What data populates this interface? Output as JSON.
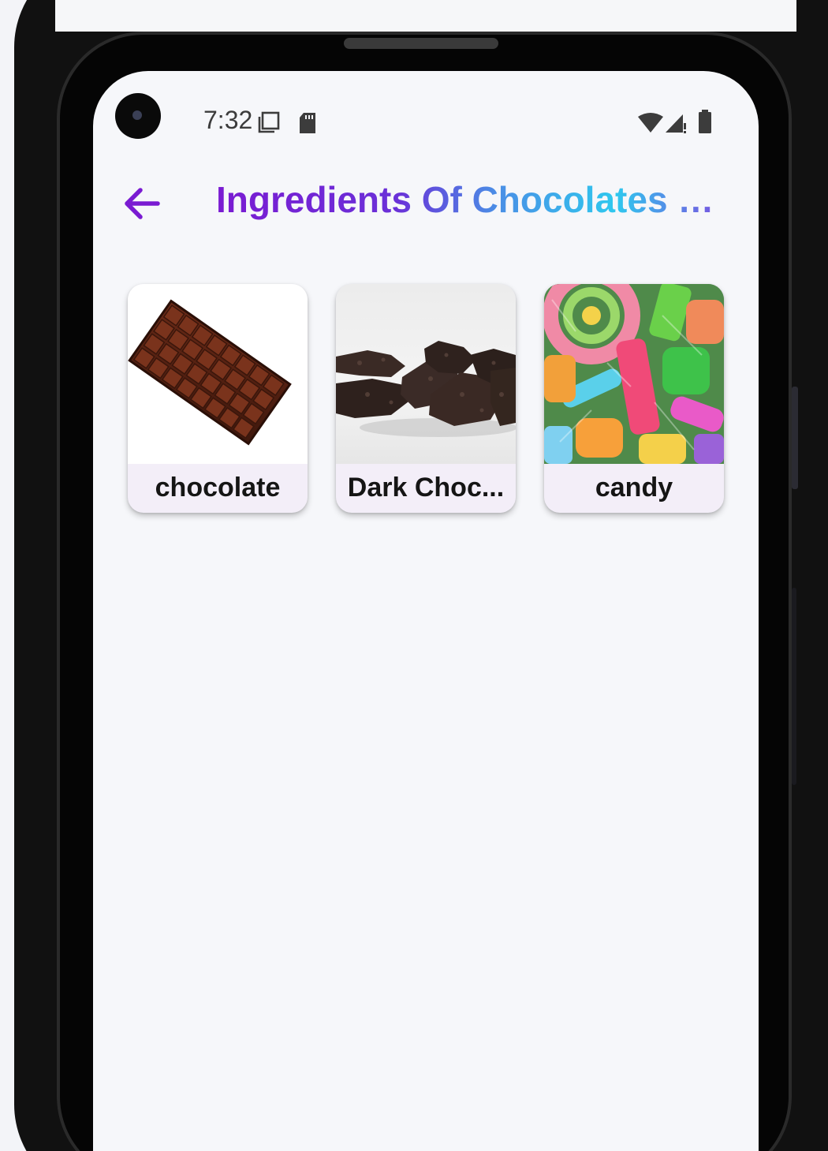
{
  "status_bar": {
    "time": "7:32",
    "icons": [
      "screen-icon",
      "sd-card-icon",
      "wifi-icon",
      "signal-icon",
      "battery-icon"
    ]
  },
  "app_bar": {
    "title": "Ingredients Of Chocolates & ...",
    "back_icon": "arrow-left-icon",
    "back_color": "#7a1bd2"
  },
  "items": [
    {
      "label": "chocolate",
      "image": "chocolate-bar"
    },
    {
      "label": "Dark Choc...",
      "image": "dark-chocolate-pieces"
    },
    {
      "label": "candy",
      "image": "sour-candy-mix"
    }
  ],
  "colors": {
    "title_gradient": [
      "#7a1bd2",
      "#4a8fe6",
      "#2fc8ee"
    ],
    "card_background": "#f3eef8",
    "screen_background": "#f6f7fa"
  }
}
